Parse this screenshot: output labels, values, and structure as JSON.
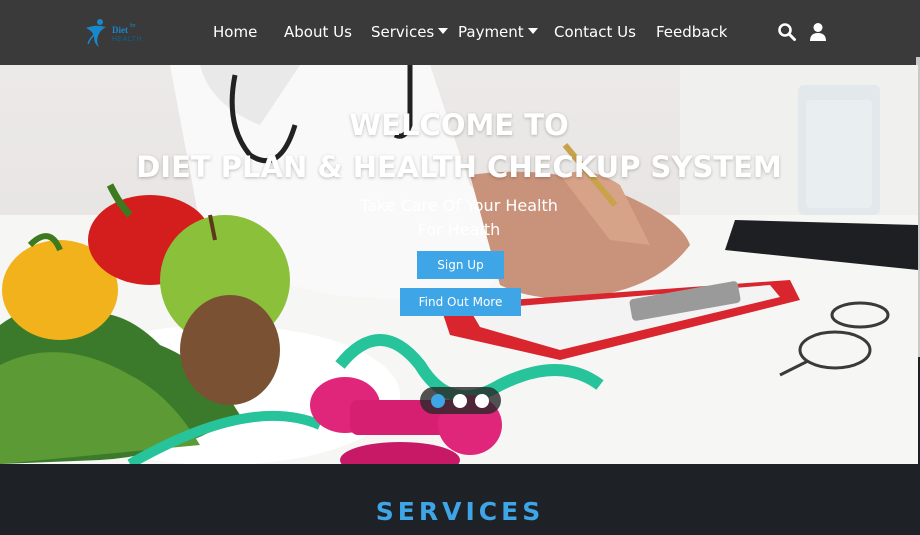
{
  "nav": {
    "logo": {
      "main": "Diet",
      "sup": "for",
      "sub": "HEALTH"
    },
    "items": [
      {
        "label": "Home"
      },
      {
        "label": "About Us"
      },
      {
        "label": "Services"
      },
      {
        "label": "Payment"
      },
      {
        "label": "Contact Us"
      },
      {
        "label": "Feedback"
      }
    ],
    "icons": [
      "search-icon",
      "user-icon"
    ]
  },
  "hero": {
    "title_line1": "WELCOME TO",
    "title_line2": "DIET PLAN & HEALTH CHECKUP SYSTEM",
    "subtitle_line1": "Take Care Of Your Health",
    "subtitle_line2": "For Health",
    "signup_label": "Sign Up",
    "find_label": "Find Out More",
    "carousel": {
      "slides": 3,
      "active": 1
    }
  },
  "services": {
    "title": "SERVICES"
  },
  "colors": {
    "accent": "#3ea5e6",
    "navbar": "#3a3a3a",
    "footer_band": "#1e2227"
  }
}
